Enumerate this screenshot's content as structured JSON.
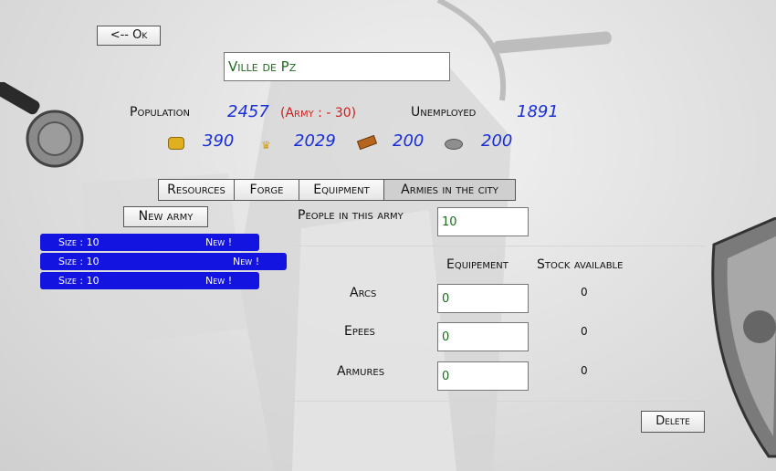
{
  "back_button": "<-- Ok",
  "city_name": "Ville de Pz",
  "stats": {
    "population_label": "Population",
    "population_value": "2457",
    "army_note": "(Army : - 30)",
    "unemployed_label": "Unemployed",
    "unemployed_value": "1891"
  },
  "resources": [
    {
      "icon": "gold-icon",
      "value": "390"
    },
    {
      "icon": "crown-icon",
      "value": "2029"
    },
    {
      "icon": "wood-icon",
      "value": "200"
    },
    {
      "icon": "stone-icon",
      "value": "200"
    }
  ],
  "tabs": [
    "Resources",
    "Forge",
    "Equipment",
    "Armies in the city"
  ],
  "active_tab": "Armies in the city",
  "new_army_button": "New army",
  "armies": [
    {
      "size": "Size : 10",
      "status": "New !"
    },
    {
      "size": "Size : 10",
      "status": "New !"
    },
    {
      "size": "Size : 10",
      "status": "New !"
    }
  ],
  "people_label": "People in this army",
  "people_value": "10",
  "columns": {
    "equipment": "Equipement",
    "stock": "Stock available"
  },
  "equipment_rows": [
    {
      "name": "Arcs",
      "value": "0",
      "stock": "0"
    },
    {
      "name": "Epees",
      "value": "0",
      "stock": "0"
    },
    {
      "name": "Armures",
      "value": "0",
      "stock": "0"
    }
  ],
  "delete_button": "Delete"
}
